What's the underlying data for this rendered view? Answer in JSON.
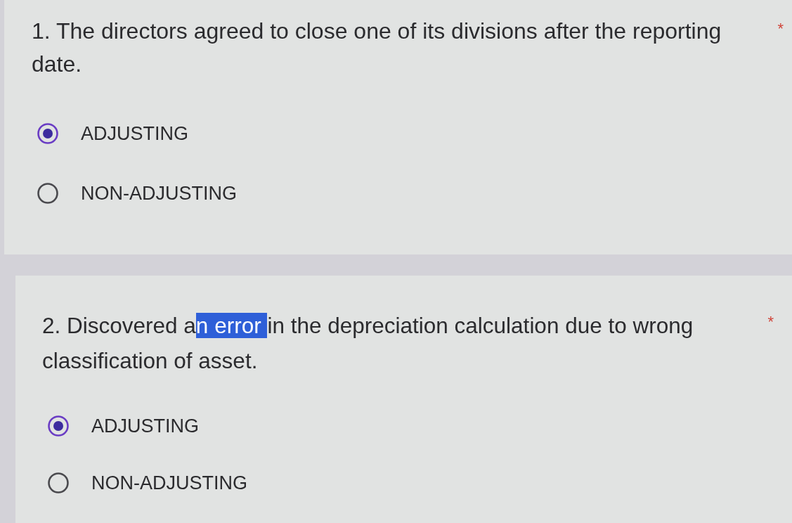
{
  "questions": [
    {
      "title": [
        {
          "text": "1. The directors agreed to close one of its divisions after the reporting date.",
          "highlighted": false
        }
      ],
      "required_mark": "*",
      "options": [
        {
          "label": "ADJUSTING",
          "selected": true
        },
        {
          "label": "NON-ADJUSTING",
          "selected": false
        }
      ]
    },
    {
      "title": [
        {
          "text": "2. Discovered a",
          "highlighted": false
        },
        {
          "text": "n error ",
          "highlighted": true
        },
        {
          "text": "in the depreciation calculation due to wrong classification of asset.",
          "highlighted": false
        }
      ],
      "required_mark": "*",
      "options": [
        {
          "label": "ADJUSTING",
          "selected": true
        },
        {
          "label": "NON-ADJUSTING",
          "selected": false
        }
      ]
    }
  ]
}
